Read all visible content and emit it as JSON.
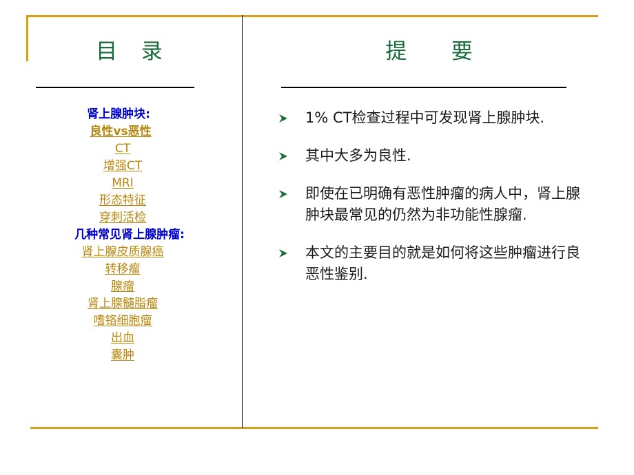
{
  "slide": {
    "accent_gold": "#D4A017",
    "heading_green": "#1A6B3C",
    "link_gold": "#B8860B",
    "section_blue": "#0000CC",
    "bullet_marker_icon": "green-arrow-bullet-icon"
  },
  "left_column": {
    "title": "目  录",
    "items": [
      {
        "label": "肾上腺肿块:",
        "type": "heading"
      },
      {
        "label": "良性vs恶性",
        "type": "link_bold"
      },
      {
        "label": "CT",
        "type": "link"
      },
      {
        "label": "增强CT",
        "type": "link"
      },
      {
        "label": "MRI",
        "type": "link"
      },
      {
        "label": "形态特征",
        "type": "link"
      },
      {
        "label": "穿刺活检",
        "type": "link"
      },
      {
        "label": "几种常见肾上腺肿瘤:",
        "type": "heading"
      },
      {
        "label": "肾上腺皮质腺癌",
        "type": "link"
      },
      {
        "label": "转移瘤",
        "type": "link"
      },
      {
        "label": "腺瘤",
        "type": "link"
      },
      {
        "label": "肾上腺髓脂瘤",
        "type": "link"
      },
      {
        "label": "嗜铬细胞瘤",
        "type": "link"
      },
      {
        "label": "出血",
        "type": "link"
      },
      {
        "label": "囊肿",
        "type": "link"
      }
    ]
  },
  "right_column": {
    "title": "提    要",
    "bullets": [
      "1% CT检查过程中可发现肾上腺肿块.",
      "其中大多为良性.",
      "即使在已明确有恶性肿瘤的病人中，肾上腺肿块最常见的仍然为非功能性腺瘤.",
      "本文的主要目的就是如何将这些肿瘤进行良恶性鉴别."
    ]
  }
}
